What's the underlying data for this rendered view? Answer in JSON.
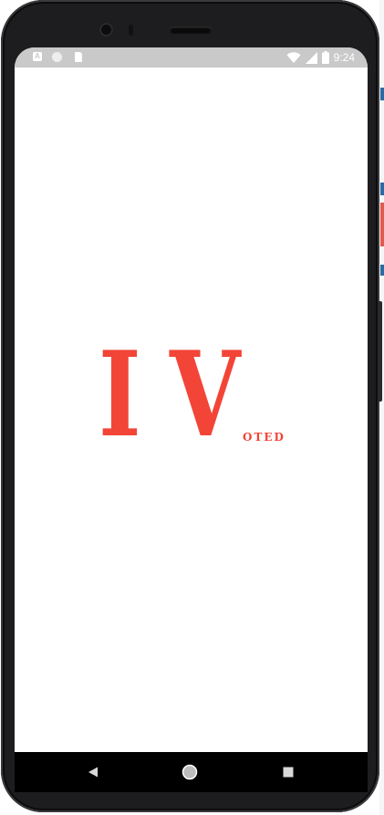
{
  "status_bar": {
    "time": "9:24",
    "left_icons": [
      "a-notification-icon",
      "circle-notification-icon",
      "sd-card-icon"
    ],
    "right_icons": [
      "wifi-icon",
      "signal-icon",
      "battery-icon"
    ],
    "notification_letter": "A"
  },
  "splash": {
    "logo_letter_1": "I",
    "logo_letter_2": "V",
    "logo_suffix": "OTED",
    "accent_color": "#f24537"
  },
  "nav_bar": {
    "buttons": [
      "back-icon",
      "home-icon",
      "recents-icon"
    ]
  }
}
